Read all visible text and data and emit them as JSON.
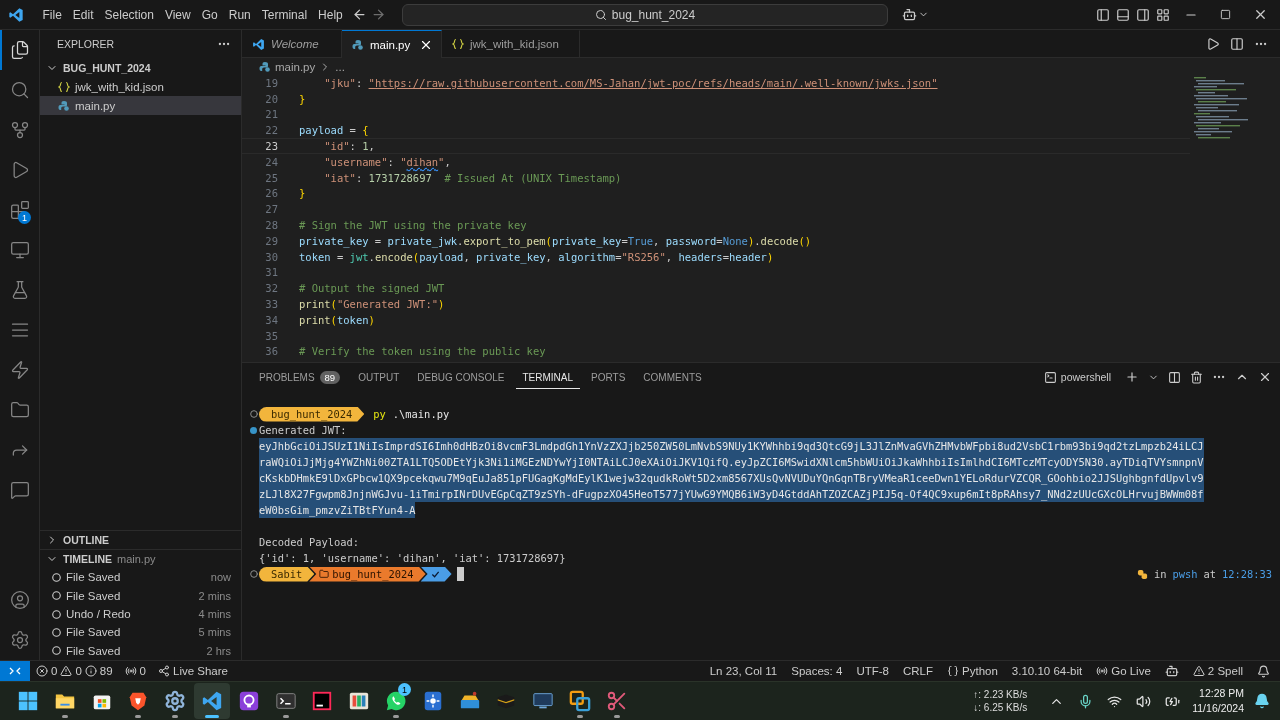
{
  "title_bar": {
    "menu": [
      "File",
      "Edit",
      "Selection",
      "View",
      "Go",
      "Run",
      "Terminal",
      "Help"
    ],
    "search": "bug_hunt_2024"
  },
  "activity_bar": {
    "items": [
      {
        "kind": "explorer",
        "selected": true
      },
      {
        "kind": "search",
        "selected": false
      },
      {
        "kind": "source_control",
        "selected": false
      },
      {
        "kind": "run",
        "selected": false
      },
      {
        "kind": "extensions",
        "selected": false,
        "badge": "1"
      },
      {
        "kind": "remote",
        "selected": false
      },
      {
        "kind": "testing",
        "selected": false
      },
      {
        "kind": "list",
        "selected": false
      },
      {
        "kind": "bolt",
        "selected": false
      },
      {
        "kind": "folder",
        "selected": false
      },
      {
        "kind": "share",
        "selected": false
      },
      {
        "kind": "chat",
        "selected": false
      }
    ],
    "bottom": [
      {
        "kind": "account"
      },
      {
        "kind": "settings"
      }
    ]
  },
  "sidebar": {
    "title": "EXPLORER",
    "folder": {
      "name": "BUG_HUNT_2024",
      "expanded": true
    },
    "files": [
      {
        "name": "jwk_with_kid.json",
        "kind": "json",
        "selected": false
      },
      {
        "name": "main.py",
        "kind": "python",
        "selected": true
      }
    ],
    "outline": {
      "title": "OUTLINE",
      "expanded": false
    },
    "timeline": {
      "title": "TIMELINE",
      "file": "main.py",
      "expanded": true,
      "items": [
        {
          "label": "File Saved",
          "time": "now"
        },
        {
          "label": "File Saved",
          "time": "2 mins"
        },
        {
          "label": "Undo / Redo",
          "time": "4 mins"
        },
        {
          "label": "File Saved",
          "time": "5 mins"
        },
        {
          "label": "File Saved",
          "time": "2 hrs"
        }
      ]
    }
  },
  "editor": {
    "tabs": [
      {
        "label": "Welcome",
        "kind": "welcome",
        "selected": false
      },
      {
        "label": "main.py",
        "kind": "python",
        "selected": true
      },
      {
        "label": "jwk_with_kid.json",
        "kind": "json",
        "selected": false
      }
    ],
    "breadcrumb": {
      "file": "main.py",
      "rest": "..."
    },
    "lines": [
      {
        "number": "19",
        "current": false,
        "tokens": [
          {
            "kind": "string",
            "text": "    \"jku\""
          },
          {
            "kind": "plain",
            "text": ": "
          },
          {
            "kind": "link",
            "text": "\"https://raw.githubusercontent.com/MS-Jahan/jwt-poc/refs/heads/main/.well-known/jwks.json\""
          }
        ]
      },
      {
        "number": "20",
        "current": false,
        "tokens": [
          {
            "kind": "brace",
            "text": "}"
          }
        ]
      },
      {
        "number": "21",
        "current": false
      },
      {
        "number": "22",
        "current": false,
        "tokens": [
          {
            "kind": "var",
            "text": "payload"
          },
          {
            "kind": "plain",
            "text": " = "
          },
          {
            "kind": "brace",
            "text": "{"
          }
        ]
      },
      {
        "number": "23",
        "current": true,
        "tokens": [
          {
            "kind": "string",
            "text": "    \"id\""
          },
          {
            "kind": "plain",
            "text": ": "
          },
          {
            "kind": "number",
            "text": "1"
          },
          {
            "kind": "plain",
            "text": ","
          }
        ]
      },
      {
        "number": "24",
        "current": false,
        "tokens": [
          {
            "kind": "string",
            "text": "    \"username\""
          },
          {
            "kind": "plain",
            "text": ": "
          },
          {
            "kind": "string",
            "text": "\""
          },
          {
            "kind": "string_spell",
            "text": "dihan"
          },
          {
            "kind": "string",
            "text": "\""
          },
          {
            "kind": "plain",
            "text": ","
          }
        ]
      },
      {
        "number": "25",
        "current": false,
        "tokens": [
          {
            "kind": "string",
            "text": "    \"iat\""
          },
          {
            "kind": "plain",
            "text": ": "
          },
          {
            "kind": "number",
            "text": "1731728697"
          },
          {
            "kind": "comment",
            "text": "  # Issued At (UNIX Timestamp)"
          }
        ]
      },
      {
        "number": "26",
        "current": false,
        "tokens": [
          {
            "kind": "brace",
            "text": "}"
          }
        ]
      },
      {
        "number": "27",
        "current": false
      },
      {
        "number": "28",
        "current": false,
        "tokens": [
          {
            "kind": "comment",
            "text": "# Sign the JWT using the private key"
          }
        ]
      },
      {
        "number": "29",
        "current": false,
        "tokens": [
          {
            "kind": "var",
            "text": "private_key"
          },
          {
            "kind": "plain",
            "text": " = "
          },
          {
            "kind": "var",
            "text": "private_jwk"
          },
          {
            "kind": "plain",
            "text": "."
          },
          {
            "kind": "func",
            "text": "export_to_pem"
          },
          {
            "kind": "paren",
            "text": "("
          },
          {
            "kind": "var",
            "text": "private_key"
          },
          {
            "kind": "plain",
            "text": "="
          },
          {
            "kind": "const",
            "text": "True"
          },
          {
            "kind": "plain",
            "text": ", "
          },
          {
            "kind": "var",
            "text": "password"
          },
          {
            "kind": "plain",
            "text": "="
          },
          {
            "kind": "const",
            "text": "None"
          },
          {
            "kind": "paren",
            "text": ")"
          },
          {
            "kind": "plain",
            "text": "."
          },
          {
            "kind": "func",
            "text": "decode"
          },
          {
            "kind": "paren",
            "text": "()"
          }
        ]
      },
      {
        "number": "30",
        "current": false,
        "tokens": [
          {
            "kind": "var",
            "text": "token"
          },
          {
            "kind": "plain",
            "text": " = "
          },
          {
            "kind": "module",
            "text": "jwt"
          },
          {
            "kind": "plain",
            "text": "."
          },
          {
            "kind": "func",
            "text": "encode"
          },
          {
            "kind": "paren",
            "text": "("
          },
          {
            "kind": "var",
            "text": "payload"
          },
          {
            "kind": "plain",
            "text": ", "
          },
          {
            "kind": "var",
            "text": "private_key"
          },
          {
            "kind": "plain",
            "text": ", "
          },
          {
            "kind": "var",
            "text": "algorithm"
          },
          {
            "kind": "plain",
            "text": "="
          },
          {
            "kind": "string",
            "text": "\"RS256\""
          },
          {
            "kind": "plain",
            "text": ", "
          },
          {
            "kind": "var",
            "text": "headers"
          },
          {
            "kind": "plain",
            "text": "="
          },
          {
            "kind": "var",
            "text": "header"
          },
          {
            "kind": "paren",
            "text": ")"
          }
        ]
      },
      {
        "number": "31",
        "current": false
      },
      {
        "number": "32",
        "current": false,
        "tokens": [
          {
            "kind": "comment",
            "text": "# Output the signed JWT"
          }
        ]
      },
      {
        "number": "33",
        "current": false,
        "tokens": [
          {
            "kind": "func",
            "text": "print"
          },
          {
            "kind": "paren",
            "text": "("
          },
          {
            "kind": "string",
            "text": "\"Generated JWT:\""
          },
          {
            "kind": "paren",
            "text": ")"
          }
        ]
      },
      {
        "number": "34",
        "current": false,
        "tokens": [
          {
            "kind": "func",
            "text": "print"
          },
          {
            "kind": "paren",
            "text": "("
          },
          {
            "kind": "var",
            "text": "token"
          },
          {
            "kind": "paren",
            "text": ")"
          }
        ]
      },
      {
        "number": "35",
        "current": false
      },
      {
        "number": "36",
        "current": false,
        "tokens": [
          {
            "kind": "comment",
            "text": "# Verify the token using the public key"
          }
        ]
      }
    ]
  },
  "panel": {
    "tabs": [
      {
        "label": "PROBLEMS",
        "badge": "89",
        "selected": false
      },
      {
        "label": "OUTPUT",
        "selected": false
      },
      {
        "label": "DEBUG CONSOLE",
        "selected": false
      },
      {
        "label": "TERMINAL",
        "selected": true
      },
      {
        "label": "PORTS",
        "selected": false
      },
      {
        "label": "COMMENTS",
        "selected": false
      }
    ],
    "shell": "powershell"
  },
  "terminal": {
    "rows": [
      {
        "kind": "prompt",
        "command_mark": true,
        "success_mark": false,
        "segments": [
          {
            "kind": "text",
            "text": "bug_hunt_2024",
            "color": "#f2b53c"
          }
        ],
        "command": "py",
        "args": ".\\main.py"
      },
      {
        "kind": "text",
        "command_mark": false,
        "success_mark": true,
        "text": "Generated JWT:",
        "selected": false
      },
      {
        "kind": "text",
        "text": "eyJhbGciOiJSUzI1NiIsImprdSI6Imh0dHBzOi8vcmF3LmdpdGh1YnVzZXJjb250ZW50LmNvbS9NUy1KYWhhbi9qd3QtcG9jL3JlZnMvaGVhZHMvbWFpbi8ud2VsbC1rbm93bi9qd2tzLmpzb24iLCJ",
        "selected": true
      },
      {
        "kind": "text",
        "text": "raWQiOiJjMjg4YWZhNi00ZTA1LTQ5ODEtYjk3Ni1iMGEzNDYwYjI0NTAiLCJ0eXAiOiJKV1QifQ.eyJpZCI6MSwidXNlcm5hbWUiOiJkaWhhbiIsImlhdCI6MTczMTcyODY5N30.ayTDiqTVYsmnpnV",
        "selected": true
      },
      {
        "kind": "text",
        "text": "cKskbDHmkE9lDxGPbcw1QX9pcekqwu7M9qEuJa851pFUGagKgMdEylK1wejw32qudkRoWt5D2xm8567XUsQvNVUDuYQnGqnTBryVMeaR1ceeDwn1YELoRdurVZCQR_GOohbio2JJSUghbgnfdUpvlv9",
        "selected": true
      },
      {
        "kind": "text",
        "text": "zLJl8X27Fgwpm8JnjnWGJvu-1iTmirpINrDUvEGpCqZT9zSYh-dFugpzXO45HeoT577jYUwG9YMQB6iW3yD4GtddAhTZOZCAZjPIJ5q-Of4QC9xup6mIt8pRAhsy7_NNd2zUUcGXcOLHrvujBWWm08f",
        "selected": true
      },
      {
        "kind": "text",
        "text": "eW0bsGim_pmzvZiTBtFYun4-A",
        "selected": true
      },
      {
        "kind": "blank"
      },
      {
        "kind": "text",
        "text": "Decoded Payload:",
        "selected": false
      },
      {
        "kind": "text",
        "text": "{'id': 1, 'username': 'dihan', 'iat': 1731728697}",
        "selected": false
      },
      {
        "kind": "prompt",
        "command_mark": true,
        "success_mark": false,
        "segments": [
          {
            "kind": "text",
            "text": "Sabit",
            "color": "#f2b53c"
          },
          {
            "kind": "folder",
            "text": "bug_hunt_2024",
            "color": "#ea7a2c"
          },
          {
            "kind": "check",
            "color": "#4a9de6"
          }
        ],
        "cursor": true,
        "right": {
          "in": "in",
          "shell": "pwsh",
          "at": "at",
          "time": "12:28:33"
        }
      }
    ]
  },
  "status_bar": {
    "problems": {
      "errors": "0",
      "warnings": "0",
      "infos": "89"
    },
    "ports": "0",
    "live_share": "Live Share",
    "right": [
      {
        "kind": "text",
        "text": "Ln 23, Col 11"
      },
      {
        "kind": "text",
        "text": "Spaces: 4"
      },
      {
        "kind": "text",
        "text": "UTF-8"
      },
      {
        "kind": "text",
        "text": "CRLF"
      },
      {
        "kind": "language",
        "text": "Python"
      },
      {
        "kind": "text",
        "text": "3.10.10 64-bit"
      },
      {
        "kind": "golive",
        "text": "Go Live"
      },
      {
        "kind": "copilot"
      },
      {
        "kind": "warning",
        "text": "2 Spell"
      },
      {
        "kind": "bell"
      }
    ]
  },
  "taskbar": {
    "apps": [
      {
        "kind": "start",
        "running": false,
        "active": false
      },
      {
        "kind": "folder",
        "running": true,
        "active": false
      },
      {
        "kind": "store",
        "running": false,
        "active": false
      },
      {
        "kind": "brave",
        "running": true,
        "active": false
      },
      {
        "kind": "settings",
        "running": true,
        "active": false
      },
      {
        "kind": "vscode",
        "running": true,
        "active": true
      },
      {
        "kind": "ring",
        "running": false,
        "active": false
      },
      {
        "kind": "terminal",
        "running": true,
        "active": false
      },
      {
        "kind": "ide",
        "running": false,
        "active": false
      },
      {
        "kind": "palette",
        "running": false,
        "active": false
      },
      {
        "kind": "whatsapp",
        "running": true,
        "active": false,
        "badge": "1"
      },
      {
        "kind": "star",
        "running": false,
        "active": false
      },
      {
        "kind": "chest",
        "running": false,
        "active": false
      },
      {
        "kind": "cube",
        "running": false,
        "active": false
      },
      {
        "kind": "monitor",
        "running": false,
        "active": false
      },
      {
        "kind": "squares",
        "running": true,
        "active": false
      },
      {
        "kind": "snip",
        "running": true,
        "active": false
      }
    ],
    "network": {
      "up": "↑: 2.23 KB/s",
      "down": "↓: 6.25 KB/s"
    },
    "time": "12:28 PM",
    "date": "11/16/2024"
  }
}
